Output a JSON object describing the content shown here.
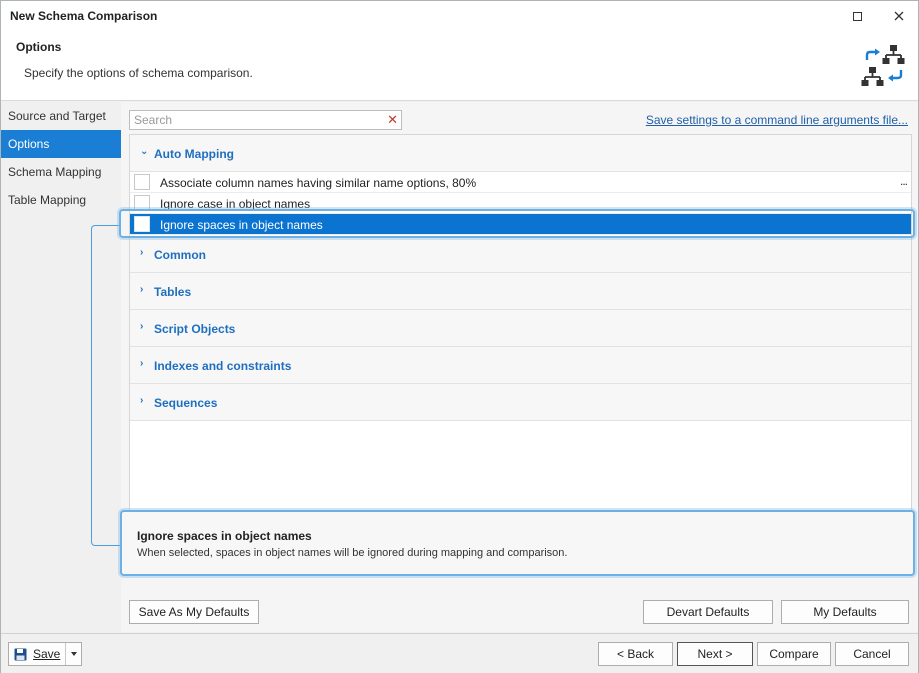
{
  "window": {
    "title": "New Schema Comparison"
  },
  "header": {
    "title": "Options",
    "subtitle": "Specify the options of schema comparison.",
    "icon": "schema-compare-icon"
  },
  "sidebar": {
    "items": [
      {
        "label": "Source and Target",
        "active": false
      },
      {
        "label": "Options",
        "active": true
      },
      {
        "label": "Schema Mapping",
        "active": false
      },
      {
        "label": "Table Mapping",
        "active": false
      }
    ]
  },
  "search": {
    "placeholder": "Search",
    "value": ""
  },
  "save_settings_link": "Save settings to a command line arguments file...",
  "groups": [
    {
      "label": "Auto Mapping",
      "expanded": true
    },
    {
      "label": "Common",
      "expanded": false
    },
    {
      "label": "Tables",
      "expanded": false
    },
    {
      "label": "Script Objects",
      "expanded": false
    },
    {
      "label": "Indexes and constraints",
      "expanded": false
    },
    {
      "label": "Sequences",
      "expanded": false
    }
  ],
  "auto_mapping_options": [
    {
      "label": "Associate column names having similar name options, 80%",
      "checked": false,
      "has_more": true,
      "more_label": "..."
    },
    {
      "label": "Ignore case in object names",
      "checked": false,
      "has_more": false
    },
    {
      "label": "Ignore spaces in object names",
      "checked": false,
      "has_more": false,
      "selected": true
    }
  ],
  "description": {
    "title": "Ignore spaces in object names",
    "text": "When selected, spaces in object names will be ignored during mapping and comparison."
  },
  "buttons": {
    "save_as_defaults": "Save As My Defaults",
    "devart_defaults": "Devart Defaults",
    "my_defaults": "My Defaults",
    "save": "Save",
    "back": "< Back",
    "next": "Next >",
    "compare": "Compare",
    "cancel": "Cancel"
  },
  "colors": {
    "accent": "#1a7fd4",
    "selected_row": "#0b73d0",
    "group_label": "#1f6fc0",
    "link": "#1f5fa8",
    "highlight": "#6cb0e6"
  }
}
